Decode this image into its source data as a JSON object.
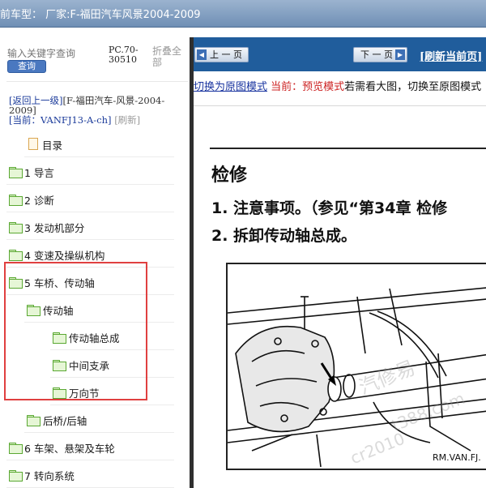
{
  "header": {
    "title": "前车型：  厂家:F-福田汽车风景2004-2009"
  },
  "search": {
    "placeholder": "输入关键字查询",
    "button_label": "查询"
  },
  "pc_code": "PC.70-30510",
  "collapse_all_label": "折叠全部",
  "nav": {
    "back_label": "[返回上一级]",
    "path": "[F-福田汽车-风景-2004-2009]",
    "current_label": "[当前：",
    "current_value": "VANFJ13-A-ch]",
    "refresh_label": "[刷新]"
  },
  "tree": [
    {
      "label": "目录",
      "icon": "document-icon"
    },
    {
      "label": "1 导言",
      "icon": "folder-icon"
    },
    {
      "label": "2 诊断",
      "icon": "folder-icon"
    },
    {
      "label": "3 发动机部分",
      "icon": "folder-icon"
    },
    {
      "label": "4 变速及操纵机构",
      "icon": "folder-icon"
    },
    {
      "label": "5 车桥、传动轴",
      "icon": "folder-open-icon"
    },
    {
      "label": "传动轴",
      "icon": "folder-open-icon"
    },
    {
      "label": "传动轴总成",
      "icon": "folder-icon"
    },
    {
      "label": "中间支承",
      "icon": "folder-icon"
    },
    {
      "label": "万向节",
      "icon": "folder-icon"
    },
    {
      "label": "后桥/后轴",
      "icon": "folder-icon"
    },
    {
      "label": "6 车架、悬架及车轮",
      "icon": "folder-icon"
    },
    {
      "label": "7 转向系统",
      "icon": "folder-icon"
    }
  ],
  "toolbar": {
    "prev_label": "上 一 页",
    "next_label": "下 一 页",
    "refresh_label": "[刷新当前页]"
  },
  "mode": {
    "switch_label": "切换为原图模式",
    "current_label": "当前：预览模式",
    "hint": "若需看大图，切换至原图模式"
  },
  "document": {
    "heading": "检修",
    "step1": "1. 注意事项。（参见“第34章 检修",
    "step2": "2. 拆卸传动轴总成。",
    "figure_code": "RM.VAN.FJ.",
    "watermark_1": "汽修易",
    "watermark_2": "t388.com",
    "watermark_3": "cr2010"
  },
  "colors": {
    "toolbar_bg": "#205d9c",
    "highlight_border": "#e04040",
    "link_blue": "#1a35a0",
    "mode_red": "#cc2222",
    "folder_green": "#5aa832"
  }
}
